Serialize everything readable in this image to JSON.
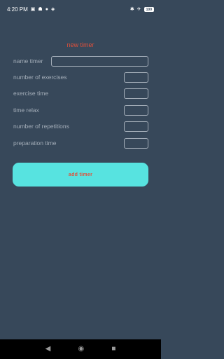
{
  "status_bar": {
    "time": "4:20 PM",
    "battery": "100"
  },
  "form": {
    "title": "new timer",
    "fields": [
      {
        "label": "name timer"
      },
      {
        "label": "number of exercises"
      },
      {
        "label": "exercise time"
      },
      {
        "label": "time relax"
      },
      {
        "label": "number of repetitions"
      },
      {
        "label": "preparation time"
      }
    ],
    "submit_label": "add timer"
  },
  "colors": {
    "background": "#37485a",
    "accent_button": "#57e3e0",
    "title_text": "#e0503a",
    "label_text": "#a3adb8"
  },
  "icons": {
    "status_left": [
      "gallery-icon",
      "users-icon",
      "facebook-icon",
      "location-icon"
    ],
    "status_right": [
      "bluetooth-icon",
      "airplane-icon",
      "battery-icon"
    ],
    "nav": [
      "back-icon",
      "home-icon",
      "recents-icon"
    ]
  }
}
